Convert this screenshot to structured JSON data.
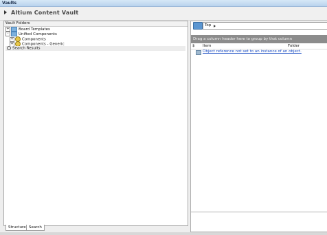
{
  "window": {
    "title": "Vaults"
  },
  "header": {
    "title": "Altium Content Vault"
  },
  "left_panel": {
    "header": "Vault Folders",
    "pin_glyph": "ᵖ",
    "tree": [
      {
        "label": "Board Templates",
        "expander": "+",
        "icon": "folder-icon",
        "indent": 0
      },
      {
        "label": "Unified Components",
        "expander": "-",
        "icon": "folder-icon",
        "indent": 0
      },
      {
        "label": "Components",
        "expander": "+",
        "icon": "component-icon",
        "indent": 1
      },
      {
        "label": "Components - Generic",
        "expander": "+",
        "icon": "component-icon",
        "indent": 1
      },
      {
        "label": "Search Results",
        "expander": "",
        "icon": "search-icon",
        "indent": 0
      }
    ],
    "tabs": [
      "Structure",
      "Search"
    ]
  },
  "right_panel": {
    "path": "Top",
    "group_hint": "Drag a column header here to group by that column",
    "columns": [
      "$",
      "Item",
      "Folder"
    ],
    "rows": [
      {
        "item": "Object reference not set to an instance of an object."
      }
    ]
  },
  "colors": {
    "titlebar": "#b9d3ee",
    "groupbar": "#8c8c8c",
    "link": "#1c4fc4"
  }
}
